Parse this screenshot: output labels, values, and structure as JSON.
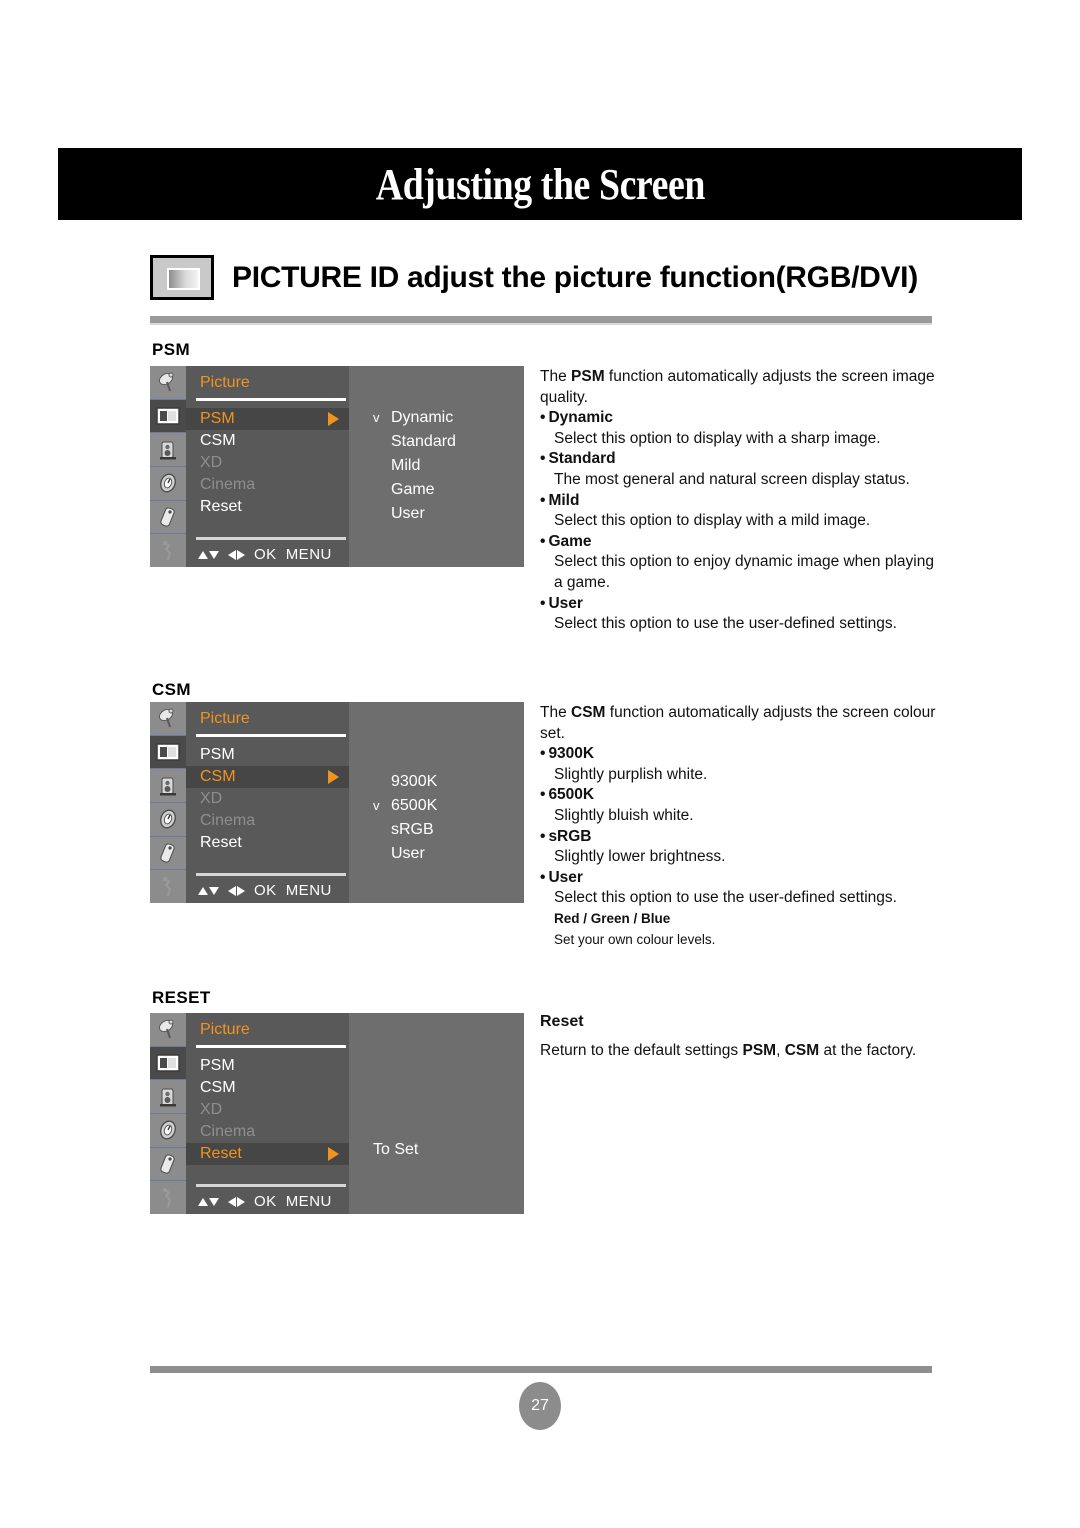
{
  "banner": {
    "title": "Adjusting the Screen"
  },
  "heading": {
    "icon": "monitor-icon",
    "title": "PICTURE ID adjust the picture function(RGB/DVI)"
  },
  "osd_common": {
    "window_title": "Picture",
    "footer": {
      "updown_icon": "up-down-arrows-icon",
      "leftright_icon": "left-right-arrows-icon",
      "ok_label": "OK",
      "menu_label": "MENU"
    },
    "rail_icons": [
      "satellite-dish-icon",
      "picture-screen-icon",
      "audio-speaker-icon",
      "timer-clock-icon",
      "remote-control-icon",
      "setup-tools-icon"
    ],
    "menu_items": [
      "PSM",
      "CSM",
      "XD",
      "Cinema",
      "Reset"
    ],
    "disabled_items": [
      "XD",
      "Cinema"
    ],
    "caret_icon": "right-triangle-icon",
    "check_icon": "v"
  },
  "colors": {
    "osd_background": "#6e6e6e",
    "osd_panel": "#595959",
    "osd_rail": "#8c8c8c",
    "osd_selected_row": "#464646",
    "accent_orange": "#f0941e",
    "banner_black": "#000000",
    "rule_gray": "#9a9a9a"
  },
  "sections": [
    {
      "label": "PSM",
      "selected_menu_item": "PSM",
      "options": [
        {
          "label": "Dynamic",
          "checked": true
        },
        {
          "label": "Standard",
          "checked": false
        },
        {
          "label": "Mild",
          "checked": false
        },
        {
          "label": "Game",
          "checked": false
        },
        {
          "label": "User",
          "checked": false
        }
      ],
      "description": {
        "lead_pre": "The ",
        "lead_bold": "PSM",
        "lead_post": " function automatically adjusts the screen image quality.",
        "bullets": [
          {
            "term": "Dynamic",
            "body": "Select this option to display with a sharp image."
          },
          {
            "term": "Standard",
            "body": "The most general and natural screen display status."
          },
          {
            "term": "Mild",
            "body": "Select this option to display with a mild image."
          },
          {
            "term": "Game",
            "body": "Select this option to enjoy dynamic image when playing a game."
          },
          {
            "term": "User",
            "body": "Select this option to use the user-defined settings."
          }
        ]
      }
    },
    {
      "label": "CSM",
      "selected_menu_item": "CSM",
      "options": [
        {
          "label": "9300K",
          "checked": false
        },
        {
          "label": "6500K",
          "checked": true
        },
        {
          "label": "sRGB",
          "checked": false
        },
        {
          "label": "User",
          "checked": false
        }
      ],
      "description": {
        "lead_pre": "The ",
        "lead_bold": "CSM",
        "lead_post": " function automatically adjusts the screen colour set.",
        "bullets": [
          {
            "term": "9300K",
            "body": "Slightly purplish white."
          },
          {
            "term": "6500K",
            "body": "Slightly bluish white."
          },
          {
            "term": "sRGB",
            "body": "Slightly lower brightness."
          },
          {
            "term": "User",
            "body": "Select this option to use the user-defined settings."
          }
        ],
        "sub_term": "Red / Green / Blue",
        "sub_body": "Set your own colour levels."
      }
    },
    {
      "label": "RESET",
      "selected_menu_item": "Reset",
      "right_text": "To Set",
      "description": {
        "title": "Reset",
        "body_pre": "Return to the default settings ",
        "body_bold1": "PSM",
        "body_mid": ", ",
        "body_bold2": "CSM",
        "body_post": " at the factory."
      }
    }
  ],
  "footer": {
    "page_number": "27"
  }
}
